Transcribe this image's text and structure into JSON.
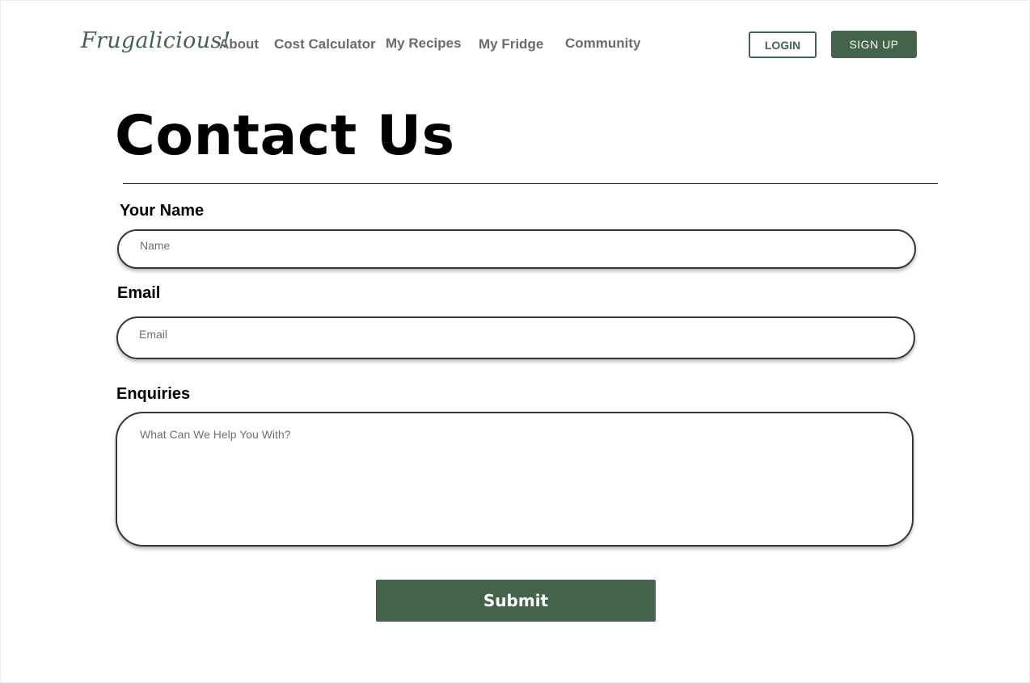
{
  "header": {
    "logo": "Frugalicious!",
    "nav": {
      "about": "About",
      "cost_calculator": "Cost Calculator",
      "my_recipes": "My Recipes",
      "my_fridge": "My Fridge",
      "community": "Community"
    },
    "login_label": "LOGIN",
    "signup_label": "SIGN UP"
  },
  "main": {
    "title": "Contact Us",
    "form": {
      "name_label": "Your Name",
      "name_placeholder": "Name",
      "name_value": "",
      "email_label": "Email",
      "email_placeholder": "Email",
      "email_value": "",
      "enquiries_label": "Enquiries",
      "enquiries_placeholder": "What Can We Help You With?",
      "enquiries_value": "",
      "submit_label": "Submit"
    }
  },
  "colors": {
    "brand_green": "#43644a",
    "nav_text": "#6b6b6b",
    "field_border": "#2f3b31"
  }
}
